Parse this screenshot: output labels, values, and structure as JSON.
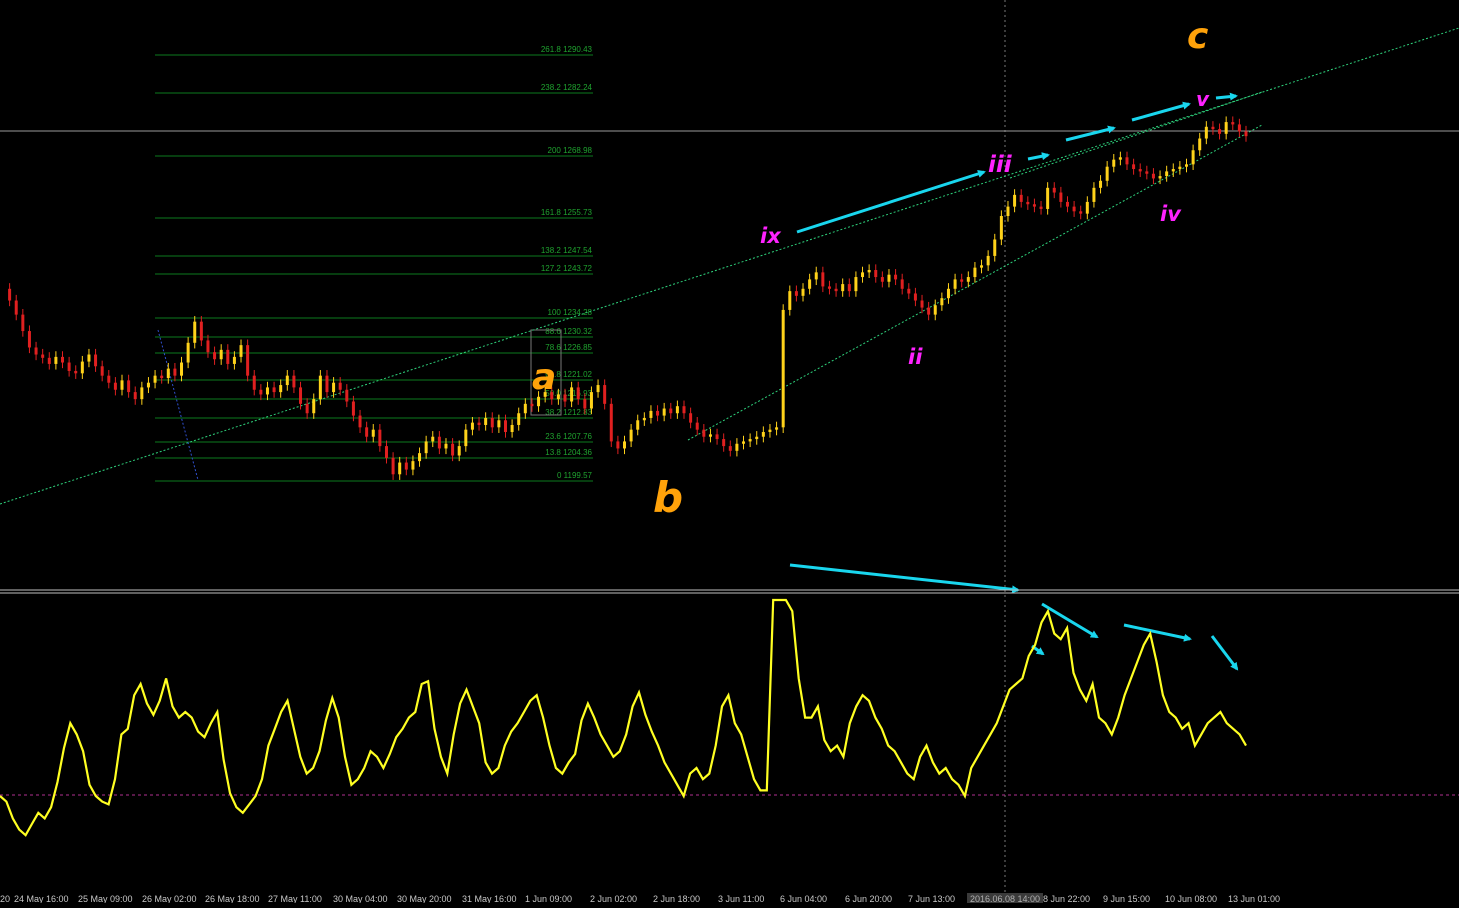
{
  "colors": {
    "background": "#000000",
    "candle_up": "#ffd21a",
    "candle_down": "#e02020",
    "channel": "#2ed17c",
    "fib": "#0b7a1e",
    "fib_text": "#1fa32f",
    "wave_major": "#ffa20a",
    "wave_minor": "#ff22ff",
    "arrow": "#19d6ee",
    "oscillator": "#ffff22",
    "oscillator_level": "#b0308f",
    "separator": "#c0c0c0"
  },
  "fibonacci": {
    "levels": [
      {
        "label": "261.8 1290.43"
      },
      {
        "label": "238.2 1282.24"
      },
      {
        "label": "200 1268.98"
      },
      {
        "label": "161.8 1255.73"
      },
      {
        "label": "138.2 1247.54"
      },
      {
        "label": "127.2 1243.72"
      },
      {
        "label": "100 1234.28"
      },
      {
        "label": "88.6 1230.32"
      },
      {
        "label": "78.6 1226.85"
      },
      {
        "label": "61.8 1221.02"
      },
      {
        "label": "50.0 1216.93"
      },
      {
        "label": "38.2 1212.83"
      },
      {
        "label": "23.6 1207.76"
      },
      {
        "label": "13.8 1204.36"
      },
      {
        "label": "0 1199.57"
      }
    ]
  },
  "waves": {
    "major_c": "c",
    "major_a": "a",
    "major_b": "b",
    "minor_i": "ix",
    "minor_ii": "ii",
    "minor_iii": "iii",
    "minor_iv": "iv",
    "minor_v": "v"
  },
  "crosshair_time": "2016.06.08 14:00",
  "time_axis": [
    "20",
    "24 May 16:00",
    "25 May 09:00",
    "26 May 02:00",
    "26 May 18:00",
    "27 May 11:00",
    "30 May 04:00",
    "30 May 20:00",
    "31 May 16:00",
    "1 Jun 09:00",
    "2 Jun 02:00",
    "2 Jun 18:00",
    "3 Jun 11:00",
    "6 Jun 04:00",
    "6 Jun 20:00",
    "7 Jun 13:00",
    "8 Jun 22:00",
    "9 Jun 15:00",
    "10 Jun 08:00",
    "13 Jun 01:00"
  ],
  "price_series": [
    1240.5,
    1238.0,
    1235.0,
    1231.5,
    1228.0,
    1226.5,
    1225.8,
    1224.5,
    1226.0,
    1224.8,
    1223.0,
    1222.5,
    1225.0,
    1226.5,
    1224.0,
    1222.0,
    1220.5,
    1219.0,
    1221.0,
    1218.5,
    1217.0,
    1219.5,
    1220.5,
    1222.0,
    1221.5,
    1223.5,
    1222.0,
    1224.8,
    1229.0,
    1233.5,
    1229.5,
    1227.0,
    1225.5,
    1227.5,
    1224.5,
    1226.0,
    1228.5,
    1222.0,
    1219.0,
    1218.0,
    1219.5,
    1218.5,
    1220.0,
    1222.0,
    1219.5,
    1216.0,
    1214.0,
    1217.0,
    1222.0,
    1218.5,
    1220.5,
    1219.0,
    1216.5,
    1213.5,
    1211.0,
    1209.0,
    1210.5,
    1207.0,
    1204.5,
    1201.0,
    1203.5,
    1202.0,
    1203.8,
    1205.5,
    1208.0,
    1209.0,
    1206.5,
    1207.5,
    1205.0,
    1207.0,
    1210.5,
    1212.0,
    1211.5,
    1213.0,
    1211.0,
    1212.5,
    1210.0,
    1211.5,
    1214.0,
    1216.0,
    1215.5,
    1217.5,
    1218.5,
    1217.0,
    1218.0,
    1216.5,
    1219.5,
    1217.0,
    1215.0,
    1218.5,
    1220.0,
    1216.0,
    1208.0,
    1206.5,
    1208.0,
    1210.5,
    1212.5,
    1213.0,
    1214.5,
    1213.5,
    1215.0,
    1214.0,
    1215.5,
    1214.0,
    1212.0,
    1210.5,
    1209.0,
    1209.5,
    1208.5,
    1207.0,
    1206.0,
    1207.5,
    1208.0,
    1208.5,
    1209.0,
    1210.0,
    1210.5,
    1211.0,
    1236.0,
    1240.0,
    1239.0,
    1240.5,
    1242.5,
    1244.0,
    1241.0,
    1240.5,
    1240.0,
    1241.5,
    1240.0,
    1243.0,
    1244.0,
    1244.5,
    1243.0,
    1242.0,
    1243.5,
    1242.5,
    1240.5,
    1239.5,
    1238.0,
    1236.5,
    1235.0,
    1237.0,
    1238.5,
    1240.5,
    1242.5,
    1242.0,
    1243.0,
    1245.0,
    1245.5,
    1247.5,
    1251.0,
    1256.0,
    1258.0,
    1260.5,
    1259.0,
    1258.5,
    1258.0,
    1257.5,
    1262.0,
    1261.0,
    1259.0,
    1258.0,
    1257.0,
    1256.5,
    1259.0,
    1262.0,
    1263.5,
    1266.5,
    1268.0,
    1268.5,
    1267.0,
    1266.0,
    1265.5,
    1265.0,
    1264.0,
    1264.5,
    1265.5,
    1266.0,
    1266.5,
    1267.0,
    1270.0,
    1272.5,
    1275.0,
    1274.5,
    1273.5,
    1276.0,
    1275.5,
    1274.0,
    1273.0
  ],
  "oscillator_series": [
    30,
    28,
    22,
    18,
    16,
    20,
    24,
    22,
    26,
    35,
    47,
    56,
    52,
    46,
    34,
    30,
    28,
    27,
    36,
    52,
    54,
    66,
    70,
    63,
    59,
    64,
    72,
    62,
    58,
    60,
    58,
    53,
    51,
    56,
    60,
    43,
    31,
    26,
    24,
    27,
    30,
    36,
    48,
    54,
    60,
    64,
    54,
    44,
    38,
    40,
    46,
    57,
    65,
    58,
    44,
    34,
    36,
    40,
    46,
    44,
    40,
    45,
    51,
    54,
    58,
    60,
    70,
    71,
    54,
    44,
    38,
    52,
    63,
    68,
    62,
    56,
    42,
    38,
    40,
    48,
    53,
    56,
    60,
    64,
    66,
    58,
    48,
    40,
    38,
    42,
    45,
    57,
    63,
    58,
    52,
    48,
    44,
    46,
    52,
    62,
    67,
    59,
    53,
    48,
    42,
    38,
    34,
    30,
    38,
    40,
    36,
    38,
    48,
    62,
    66,
    56,
    52,
    44,
    36,
    32,
    32,
    100,
    100,
    100,
    96,
    72,
    58,
    58,
    62,
    50,
    46,
    48,
    44,
    56,
    62,
    66,
    64,
    58,
    54,
    48,
    46,
    42,
    38,
    36,
    44,
    48,
    42,
    38,
    40,
    36,
    34,
    30,
    40,
    44,
    48,
    52,
    56,
    62,
    68,
    70,
    72,
    80,
    84,
    92,
    96,
    88,
    86,
    90,
    74,
    68,
    64,
    70,
    58,
    56,
    52,
    58,
    66,
    72,
    78,
    84,
    88,
    78,
    66,
    60,
    58,
    54,
    56,
    48,
    52,
    56,
    58,
    60,
    56,
    54,
    52,
    48
  ]
}
